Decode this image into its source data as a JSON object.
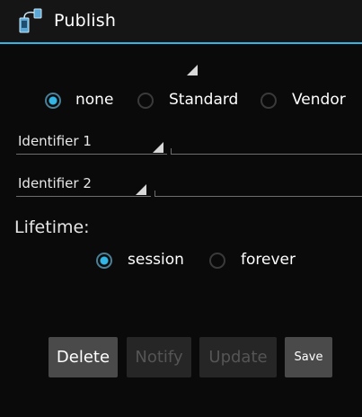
{
  "app": {
    "title": "Publish",
    "icon": "publish-app-icon",
    "accent_color": "#33b5e5"
  },
  "publish_type": {
    "options": [
      {
        "label": "none",
        "selected": true
      },
      {
        "label": "Standard",
        "selected": false
      },
      {
        "label": "Vendor",
        "selected": false
      }
    ]
  },
  "identifiers": [
    {
      "label": "Identifier 1",
      "value": ""
    },
    {
      "label": "Identifier 2",
      "value": ""
    }
  ],
  "lifetime": {
    "label": "Lifetime:",
    "options": [
      {
        "label": "session",
        "selected": true
      },
      {
        "label": "forever",
        "selected": false
      }
    ]
  },
  "buttons": {
    "delete": {
      "label": "Delete",
      "enabled": true
    },
    "notify": {
      "label": "Notify",
      "enabled": false
    },
    "update": {
      "label": "Update",
      "enabled": false
    },
    "save": {
      "label": "Save",
      "enabled": true
    }
  }
}
